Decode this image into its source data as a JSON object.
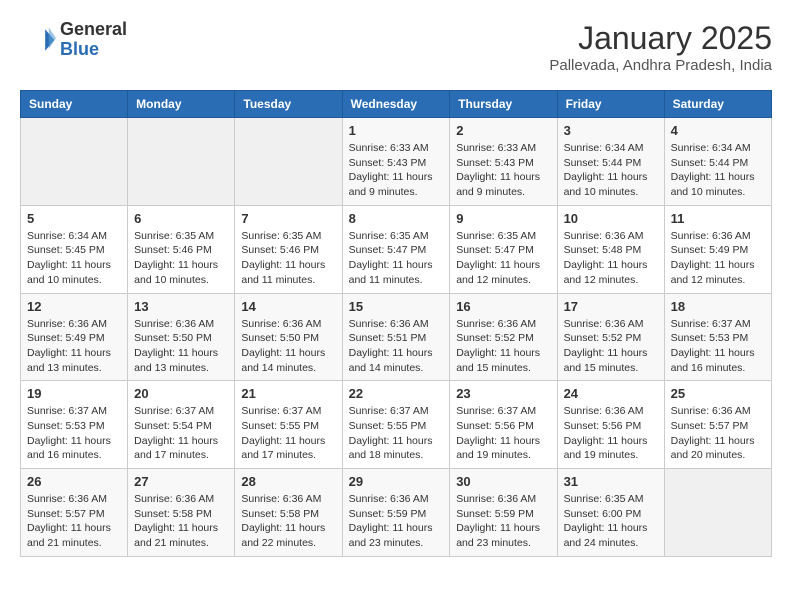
{
  "logo": {
    "general": "General",
    "blue": "Blue"
  },
  "header": {
    "month": "January 2025",
    "location": "Pallevada, Andhra Pradesh, India"
  },
  "weekdays": [
    "Sunday",
    "Monday",
    "Tuesday",
    "Wednesday",
    "Thursday",
    "Friday",
    "Saturday"
  ],
  "weeks": [
    [
      {
        "day": "",
        "info": ""
      },
      {
        "day": "",
        "info": ""
      },
      {
        "day": "",
        "info": ""
      },
      {
        "day": "1",
        "info": "Sunrise: 6:33 AM\nSunset: 5:43 PM\nDaylight: 11 hours and 9 minutes."
      },
      {
        "day": "2",
        "info": "Sunrise: 6:33 AM\nSunset: 5:43 PM\nDaylight: 11 hours and 9 minutes."
      },
      {
        "day": "3",
        "info": "Sunrise: 6:34 AM\nSunset: 5:44 PM\nDaylight: 11 hours and 10 minutes."
      },
      {
        "day": "4",
        "info": "Sunrise: 6:34 AM\nSunset: 5:44 PM\nDaylight: 11 hours and 10 minutes."
      }
    ],
    [
      {
        "day": "5",
        "info": "Sunrise: 6:34 AM\nSunset: 5:45 PM\nDaylight: 11 hours and 10 minutes."
      },
      {
        "day": "6",
        "info": "Sunrise: 6:35 AM\nSunset: 5:46 PM\nDaylight: 11 hours and 10 minutes."
      },
      {
        "day": "7",
        "info": "Sunrise: 6:35 AM\nSunset: 5:46 PM\nDaylight: 11 hours and 11 minutes."
      },
      {
        "day": "8",
        "info": "Sunrise: 6:35 AM\nSunset: 5:47 PM\nDaylight: 11 hours and 11 minutes."
      },
      {
        "day": "9",
        "info": "Sunrise: 6:35 AM\nSunset: 5:47 PM\nDaylight: 11 hours and 12 minutes."
      },
      {
        "day": "10",
        "info": "Sunrise: 6:36 AM\nSunset: 5:48 PM\nDaylight: 11 hours and 12 minutes."
      },
      {
        "day": "11",
        "info": "Sunrise: 6:36 AM\nSunset: 5:49 PM\nDaylight: 11 hours and 12 minutes."
      }
    ],
    [
      {
        "day": "12",
        "info": "Sunrise: 6:36 AM\nSunset: 5:49 PM\nDaylight: 11 hours and 13 minutes."
      },
      {
        "day": "13",
        "info": "Sunrise: 6:36 AM\nSunset: 5:50 PM\nDaylight: 11 hours and 13 minutes."
      },
      {
        "day": "14",
        "info": "Sunrise: 6:36 AM\nSunset: 5:50 PM\nDaylight: 11 hours and 14 minutes."
      },
      {
        "day": "15",
        "info": "Sunrise: 6:36 AM\nSunset: 5:51 PM\nDaylight: 11 hours and 14 minutes."
      },
      {
        "day": "16",
        "info": "Sunrise: 6:36 AM\nSunset: 5:52 PM\nDaylight: 11 hours and 15 minutes."
      },
      {
        "day": "17",
        "info": "Sunrise: 6:36 AM\nSunset: 5:52 PM\nDaylight: 11 hours and 15 minutes."
      },
      {
        "day": "18",
        "info": "Sunrise: 6:37 AM\nSunset: 5:53 PM\nDaylight: 11 hours and 16 minutes."
      }
    ],
    [
      {
        "day": "19",
        "info": "Sunrise: 6:37 AM\nSunset: 5:53 PM\nDaylight: 11 hours and 16 minutes."
      },
      {
        "day": "20",
        "info": "Sunrise: 6:37 AM\nSunset: 5:54 PM\nDaylight: 11 hours and 17 minutes."
      },
      {
        "day": "21",
        "info": "Sunrise: 6:37 AM\nSunset: 5:55 PM\nDaylight: 11 hours and 17 minutes."
      },
      {
        "day": "22",
        "info": "Sunrise: 6:37 AM\nSunset: 5:55 PM\nDaylight: 11 hours and 18 minutes."
      },
      {
        "day": "23",
        "info": "Sunrise: 6:37 AM\nSunset: 5:56 PM\nDaylight: 11 hours and 19 minutes."
      },
      {
        "day": "24",
        "info": "Sunrise: 6:36 AM\nSunset: 5:56 PM\nDaylight: 11 hours and 19 minutes."
      },
      {
        "day": "25",
        "info": "Sunrise: 6:36 AM\nSunset: 5:57 PM\nDaylight: 11 hours and 20 minutes."
      }
    ],
    [
      {
        "day": "26",
        "info": "Sunrise: 6:36 AM\nSunset: 5:57 PM\nDaylight: 11 hours and 21 minutes."
      },
      {
        "day": "27",
        "info": "Sunrise: 6:36 AM\nSunset: 5:58 PM\nDaylight: 11 hours and 21 minutes."
      },
      {
        "day": "28",
        "info": "Sunrise: 6:36 AM\nSunset: 5:58 PM\nDaylight: 11 hours and 22 minutes."
      },
      {
        "day": "29",
        "info": "Sunrise: 6:36 AM\nSunset: 5:59 PM\nDaylight: 11 hours and 23 minutes."
      },
      {
        "day": "30",
        "info": "Sunrise: 6:36 AM\nSunset: 5:59 PM\nDaylight: 11 hours and 23 minutes."
      },
      {
        "day": "31",
        "info": "Sunrise: 6:35 AM\nSunset: 6:00 PM\nDaylight: 11 hours and 24 minutes."
      },
      {
        "day": "",
        "info": ""
      }
    ]
  ]
}
